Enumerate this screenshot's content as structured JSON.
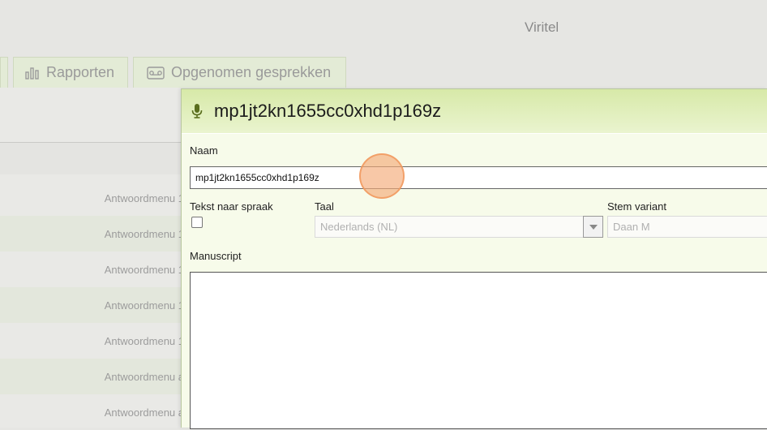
{
  "brand": "Viritel",
  "tabs": [
    {
      "label": ""
    },
    {
      "label": "Rapporten",
      "icon": "bar-chart-icon"
    },
    {
      "label": "Opgenomen gesprekken",
      "icon": "recording-icon"
    }
  ],
  "background_rows": [
    "Antwoordmenu 1",
    "Antwoordmenu 1",
    "Antwoordmenu 1",
    "Antwoordmenu 1",
    "Antwoordmenu 1",
    "Antwoordmenu a",
    "Antwoordmenu a"
  ],
  "dialog": {
    "icon": "microphone-icon",
    "title": "mp1jt2kn1655cc0xhd1p169z",
    "naam_label": "Naam",
    "naam_value": "mp1jt2kn1655cc0xhd1p169z",
    "tts_label": "Tekst naar spraak",
    "tts_checked": false,
    "taal_label": "Taal",
    "taal_value": "Nederlands (NL)",
    "stem_label": "Stem variant",
    "stem_value": "Daan  M",
    "manuscript_label": "Manuscript",
    "manuscript_value": ""
  },
  "colors": {
    "header_gradient_top": "#d7e9a8",
    "body_background": "#f7fbea",
    "click_marker": "#f5aa78"
  }
}
